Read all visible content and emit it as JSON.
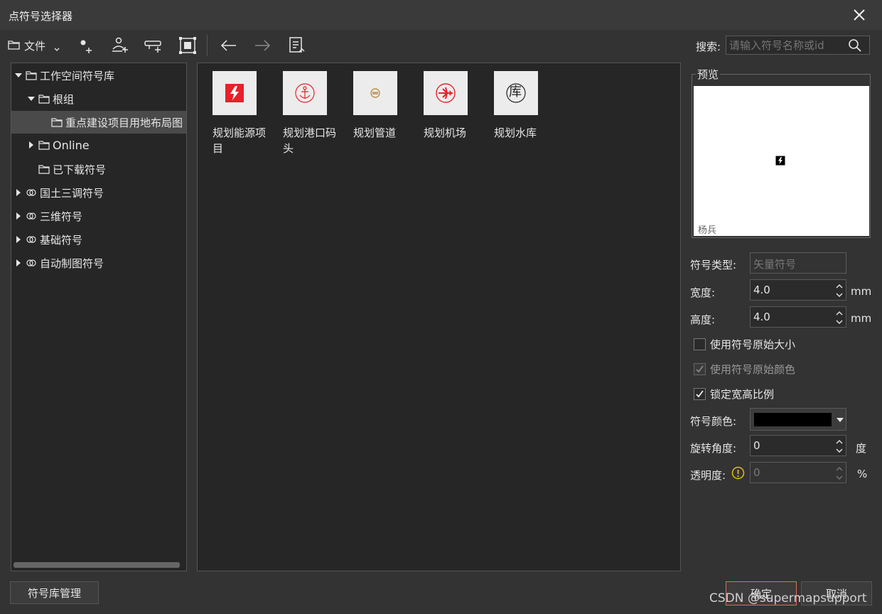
{
  "window": {
    "title": "点符号选择器"
  },
  "toolbar": {
    "file_label": "文件",
    "search_label": "搜索:",
    "search_placeholder": "请输入符号名称或id"
  },
  "tree": {
    "items": [
      {
        "label": "工作空间符号库"
      },
      {
        "label": "根组"
      },
      {
        "label": "重点建设项目用地布局图"
      },
      {
        "label": "Online"
      },
      {
        "label": "已下载符号"
      },
      {
        "label": "国土三调符号"
      },
      {
        "label": "三维符号"
      },
      {
        "label": "基础符号"
      },
      {
        "label": "自动制图符号"
      }
    ]
  },
  "symbols": [
    {
      "label": "规划能源项目",
      "icon": "energy-icon"
    },
    {
      "label": "规划港口码头",
      "icon": "anchor-icon"
    },
    {
      "label": "规划管道",
      "icon": "pipe-icon"
    },
    {
      "label": "规划机场",
      "icon": "airplane-icon"
    },
    {
      "label": "规划水库",
      "icon": "reservoir-icon",
      "glyph": "库"
    }
  ],
  "preview": {
    "legend": "预览",
    "author": "杨兵"
  },
  "properties": {
    "type_label": "符号类型:",
    "type_value": "矢量符号",
    "width_label": "宽度:",
    "width_value": "4.0",
    "width_unit": "mm",
    "height_label": "高度:",
    "height_value": "4.0",
    "height_unit": "mm",
    "cb_original_size": "使用符号原始大小",
    "cb_original_color": "使用符号原始颜色",
    "cb_lock_ratio": "锁定宽高比例",
    "color_label": "符号颜色:",
    "color_value": "#000000",
    "rotation_label": "旋转角度:",
    "rotation_value": "0",
    "rotation_unit": "度",
    "opacity_label": "透明度:",
    "opacity_value": "0",
    "opacity_unit": "%"
  },
  "footer": {
    "manage_label": "符号库管理",
    "ok_label": "确定",
    "cancel_label": "取消",
    "watermark": "CSDN @supermapsupport"
  },
  "colors": {
    "accent_border": "#e06c5c",
    "energy_red": "#e8202a",
    "warning_yellow": "#e5c100"
  }
}
